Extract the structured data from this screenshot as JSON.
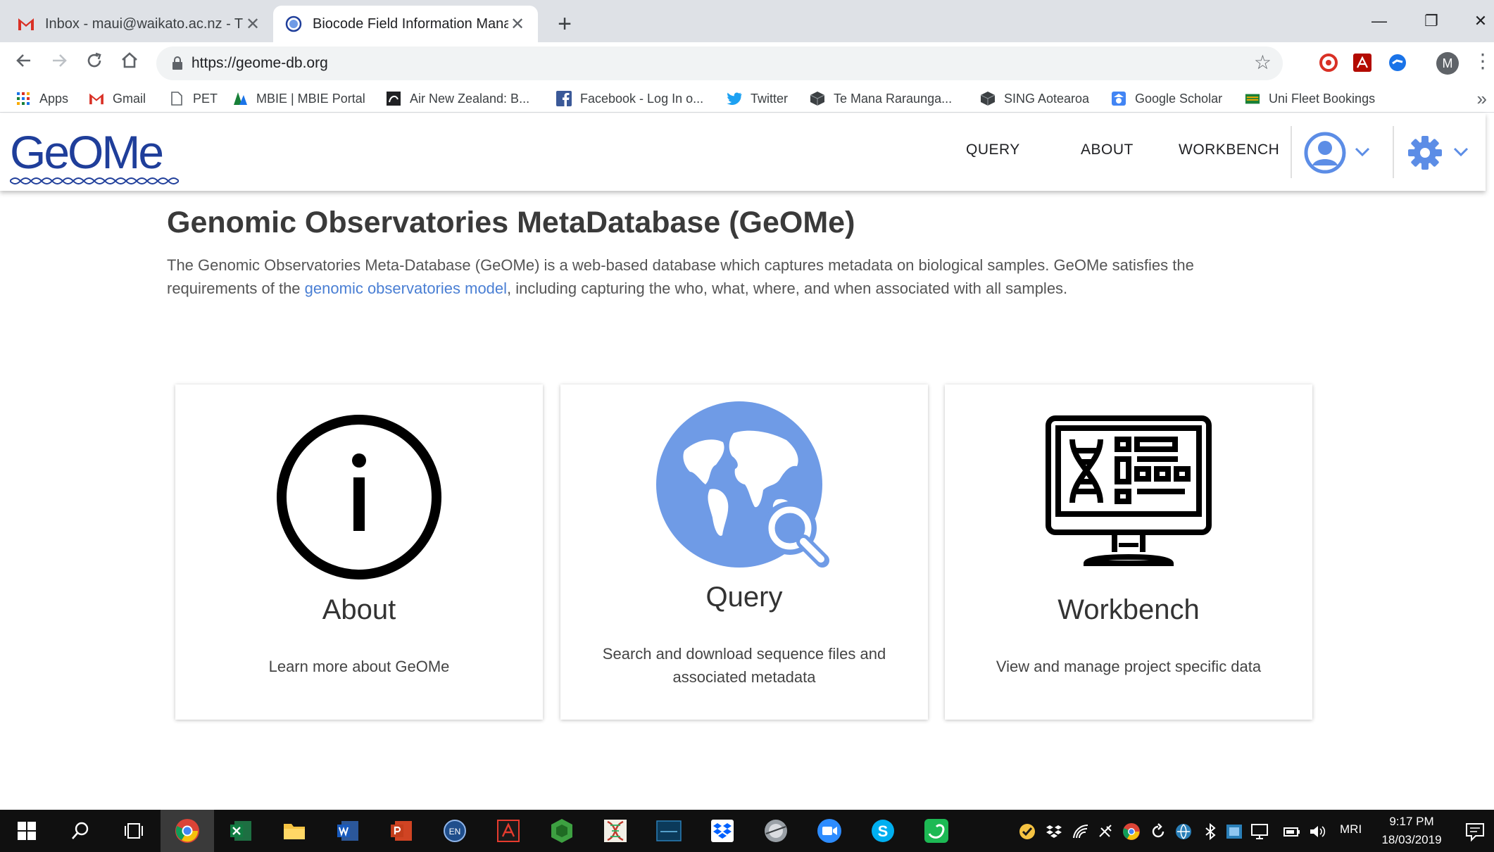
{
  "browser": {
    "tabs": [
      {
        "title": "Inbox - maui@waikato.ac.nz - Th",
        "close": "✕"
      },
      {
        "title": "Biocode Field Information Manag",
        "close": "✕"
      }
    ],
    "new_tab": "+",
    "window_controls": {
      "minimize": "—",
      "restore": "❐",
      "close": "✕"
    },
    "url": "https://geome-db.org",
    "profile_initial": "M",
    "bookmarks": [
      {
        "label": "Apps",
        "icon": "apps-grid-icon"
      },
      {
        "label": "Gmail",
        "icon": "gmail-icon"
      },
      {
        "label": "PET",
        "icon": "page-icon"
      },
      {
        "label": "MBIE | MBIE Portal",
        "icon": "mbie-icon"
      },
      {
        "label": "Air New Zealand: B...",
        "icon": "air-nz-icon"
      },
      {
        "label": "Facebook - Log In o...",
        "icon": "facebook-icon"
      },
      {
        "label": "Twitter",
        "icon": "twitter-icon"
      },
      {
        "label": "Te Mana Raraunga...",
        "icon": "cube-icon"
      },
      {
        "label": "SING Aotearoa",
        "icon": "cube-icon"
      },
      {
        "label": "Google Scholar",
        "icon": "google-scholar-icon"
      },
      {
        "label": "Uni Fleet Bookings",
        "icon": "fleet-icon"
      }
    ],
    "bookmarks_more": "»"
  },
  "site": {
    "logo_text": "GeOMe",
    "nav": {
      "query": "QUERY",
      "about": "ABOUT",
      "workbench": "WORKBENCH"
    },
    "accent_color": "#5c8de6"
  },
  "main": {
    "title": "Genomic Observatories MetaDatabase (GeOMe)",
    "intro_before": "The Genomic Observatories Meta-Database (GeOMe) is a web-based database which captures metadata on biological samples. GeOMe satisfies the requirements of the ",
    "intro_link": "genomic observatories model",
    "intro_after": ", including capturing the who, what, where, and when associated with all samples.",
    "cards": [
      {
        "title": "About",
        "description": "Learn more about GeOMe",
        "icon": "info-icon"
      },
      {
        "title": "Query",
        "description": "Search and download sequence files and associated metadata",
        "icon": "globe-search-icon"
      },
      {
        "title": "Workbench",
        "description": "View and manage project specific data",
        "icon": "monitor-dna-icon"
      }
    ]
  },
  "taskbar": {
    "language": "MRI",
    "time": "9:17 PM",
    "date": "18/03/2019"
  }
}
